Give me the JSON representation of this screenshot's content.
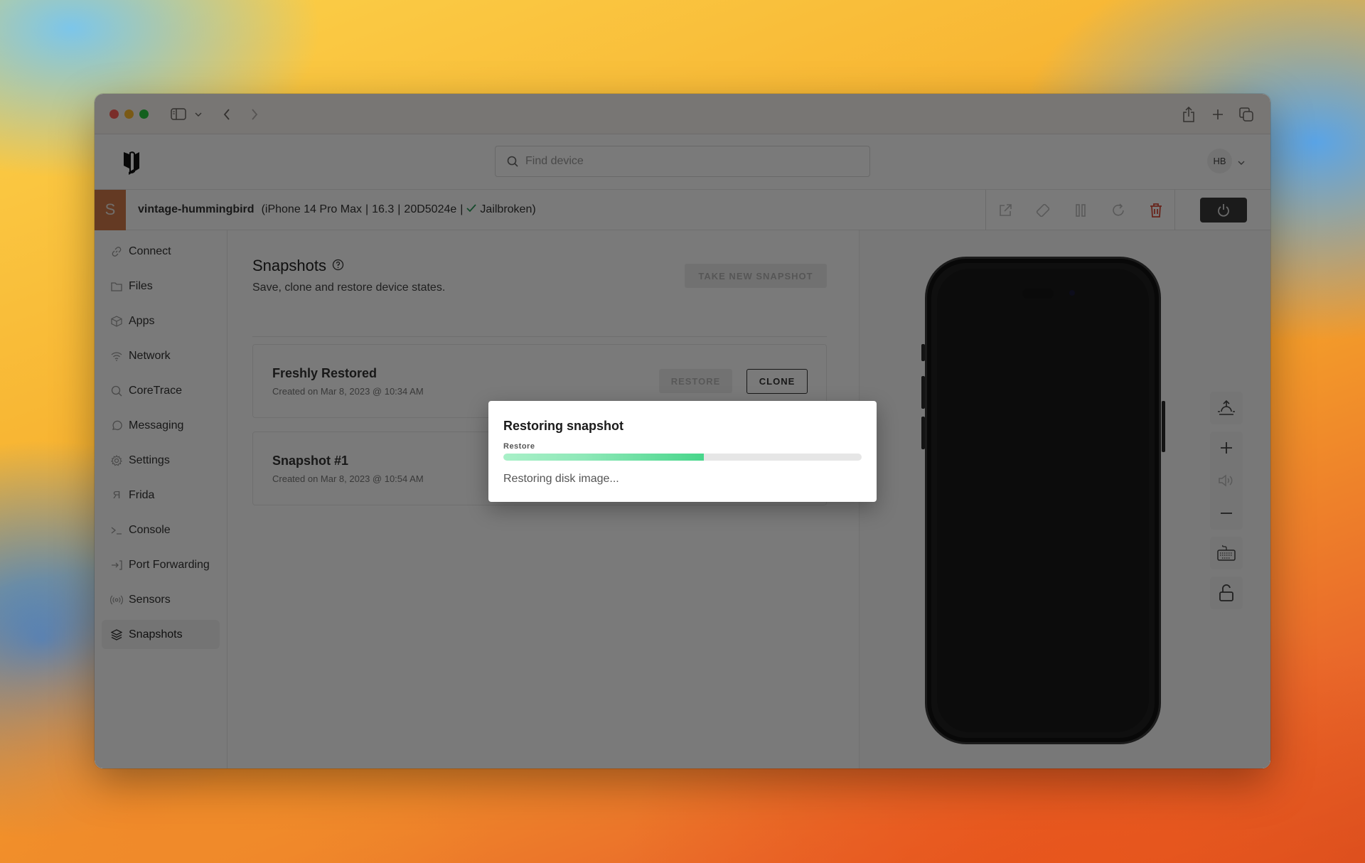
{
  "browser": {
    "back_label": "Back",
    "forward_label": "Forward"
  },
  "app": {
    "search": {
      "placeholder": "Find device",
      "value": ""
    },
    "user_initials": "HB"
  },
  "device": {
    "badge": "S",
    "name": "vintage-hummingbird",
    "model": "(iPhone 14 Pro Max",
    "version": "16.3",
    "build": "20D5024e",
    "status": "Jailbroken)",
    "status_color": "#2a9a5a"
  },
  "sidebar": {
    "items": [
      {
        "label": "Connect",
        "icon": "link-icon"
      },
      {
        "label": "Files",
        "icon": "folder-icon"
      },
      {
        "label": "Apps",
        "icon": "cube-icon"
      },
      {
        "label": "Network",
        "icon": "wifi-icon"
      },
      {
        "label": "CoreTrace",
        "icon": "search-icon"
      },
      {
        "label": "Messaging",
        "icon": "chat-bubble-icon"
      },
      {
        "label": "Settings",
        "icon": "gear-icon"
      },
      {
        "label": "Frida",
        "icon": "frida-icon"
      },
      {
        "label": "Console",
        "icon": "terminal-icon"
      },
      {
        "label": "Port Forwarding",
        "icon": "port-forward-icon"
      },
      {
        "label": "Sensors",
        "icon": "sensor-icon"
      },
      {
        "label": "Snapshots",
        "icon": "layers-icon",
        "active": true
      }
    ]
  },
  "snapshots": {
    "title": "Snapshots",
    "subtitle": "Save, clone and restore device states.",
    "take_button": "TAKE NEW SNAPSHOT",
    "restore_label": "RESTORE",
    "clone_label": "CLONE",
    "items": [
      {
        "name": "Freshly Restored",
        "created": "Created on Mar 8, 2023 @ 10:34 AM"
      },
      {
        "name": "Snapshot #1",
        "created": "Created on Mar 8, 2023 @ 10:54 AM"
      }
    ]
  },
  "modal": {
    "title": "Restoring snapshot",
    "progress_label": "Restore",
    "progress_percent": 56,
    "status": "Restoring disk image..."
  }
}
